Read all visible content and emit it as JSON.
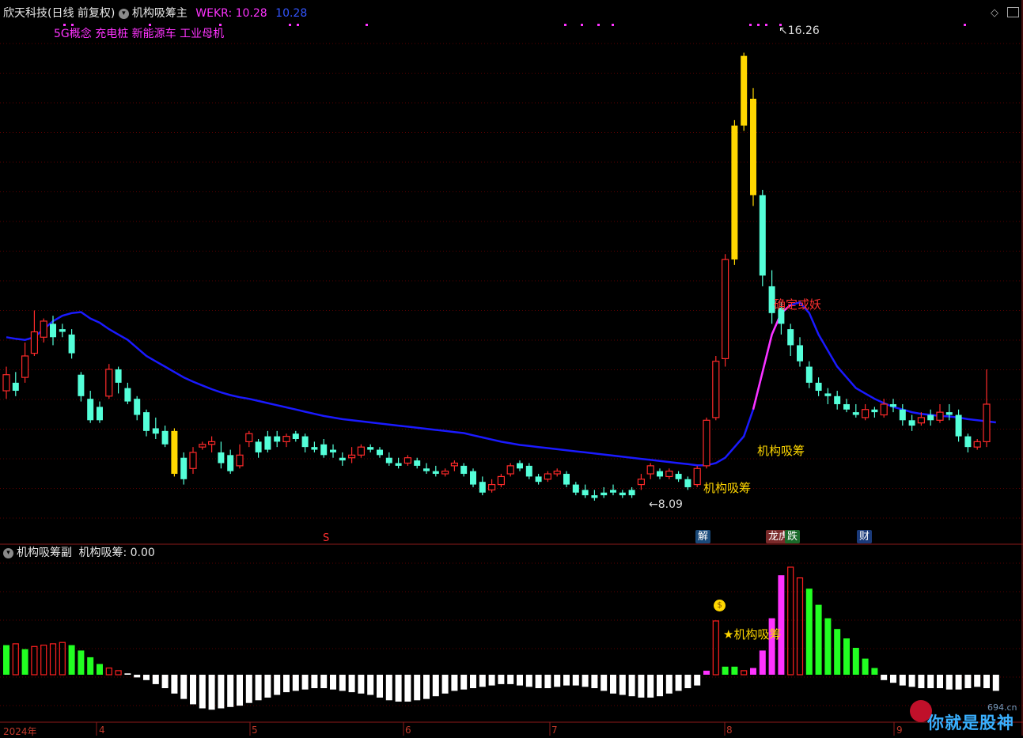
{
  "header": {
    "stock_name": "欣天科技",
    "period": "(日线 前复权)",
    "indicator": "机构吸筹主",
    "wekr_label": "WEKR:",
    "wekr_value1": "10.28",
    "wekr_value2": "10.28",
    "concepts": "5G概念 充电桩 新能源车 工业母机"
  },
  "markers": {
    "high": "16.26",
    "low": "8.09",
    "signal_main_1": "机构吸筹",
    "signal_main_2": "机构吸筹",
    "signal_sub": "★机构吸筹",
    "peak_text": "确定或妖",
    "event_s": "S",
    "event_jie": "解",
    "event_bang": "龙虎榜",
    "event_die": "跌",
    "event_cai": "财"
  },
  "sub": {
    "title": "机构吸筹副",
    "indicator": "机构吸筹:",
    "value": "0.00"
  },
  "xaxis": {
    "year": "2024年",
    "m4": "4",
    "m5": "5",
    "m6": "6",
    "m7": "7",
    "m8": "8",
    "m9": "9"
  },
  "watermark": {
    "text": "你就是股神",
    "site": "694.cn"
  },
  "colors": {
    "up": "#ff2a2a",
    "down": "#54ffd9",
    "ma": "#1a1aff",
    "accent_yellow": "#ffd700",
    "magenta": "#ff33ff",
    "bar_green": "#22ff22",
    "bar_white": "#ffffff"
  },
  "chart_data": {
    "type": "candlestick",
    "price_range": [
      7.5,
      16.8
    ],
    "candles": [
      [
        9.95,
        10.25,
        9.8,
        10.4
      ],
      [
        10.1,
        9.95,
        9.85,
        10.3
      ],
      [
        10.2,
        10.6,
        10.1,
        10.85
      ],
      [
        10.65,
        11.05,
        10.6,
        11.45
      ],
      [
        10.95,
        11.25,
        10.85,
        11.3
      ],
      [
        11.2,
        10.95,
        10.8,
        11.35
      ],
      [
        11.1,
        11.05,
        10.95,
        11.2
      ],
      [
        11.0,
        10.65,
        10.55,
        11.1
      ],
      [
        10.25,
        9.85,
        9.75,
        10.3
      ],
      [
        9.8,
        9.4,
        9.35,
        9.95
      ],
      [
        9.65,
        9.4,
        9.35,
        9.75
      ],
      [
        9.85,
        10.35,
        9.8,
        10.45
      ],
      [
        10.35,
        10.1,
        9.9,
        10.4
      ],
      [
        10.0,
        9.75,
        9.7,
        10.1
      ],
      [
        9.8,
        9.5,
        9.4,
        9.85
      ],
      [
        9.55,
        9.2,
        9.1,
        9.6
      ],
      [
        9.25,
        9.15,
        9.05,
        9.45
      ],
      [
        9.2,
        8.95,
        8.9,
        9.3
      ],
      [
        9.2,
        8.4,
        8.35,
        9.25
      ],
      [
        8.7,
        8.3,
        8.2,
        8.8
      ],
      [
        8.5,
        8.8,
        8.4,
        8.9
      ],
      [
        8.9,
        8.95,
        8.85,
        9.0
      ],
      [
        8.95,
        9.0,
        8.8,
        9.1
      ],
      [
        8.8,
        8.6,
        8.5,
        9.0
      ],
      [
        8.75,
        8.45,
        8.4,
        8.85
      ],
      [
        8.55,
        8.75,
        8.5,
        8.95
      ],
      [
        9.0,
        9.15,
        8.9,
        9.2
      ],
      [
        9.0,
        8.8,
        8.7,
        9.05
      ],
      [
        9.1,
        8.85,
        8.8,
        9.2
      ],
      [
        9.1,
        9.0,
        8.9,
        9.2
      ],
      [
        9.0,
        9.1,
        8.9,
        9.15
      ],
      [
        9.15,
        9.05,
        9.0,
        9.2
      ],
      [
        9.1,
        8.9,
        8.8,
        9.15
      ],
      [
        8.9,
        8.85,
        8.8,
        9.0
      ],
      [
        8.95,
        8.75,
        8.7,
        9.05
      ],
      [
        8.85,
        8.8,
        8.7,
        8.95
      ],
      [
        8.7,
        8.65,
        8.55,
        8.8
      ],
      [
        8.7,
        8.75,
        8.6,
        8.9
      ],
      [
        8.75,
        8.9,
        8.7,
        8.95
      ],
      [
        8.9,
        8.85,
        8.8,
        8.95
      ],
      [
        8.85,
        8.75,
        8.7,
        8.9
      ],
      [
        8.7,
        8.6,
        8.55,
        8.8
      ],
      [
        8.6,
        8.55,
        8.5,
        8.7
      ],
      [
        8.6,
        8.7,
        8.55,
        8.75
      ],
      [
        8.65,
        8.55,
        8.5,
        8.7
      ],
      [
        8.5,
        8.45,
        8.4,
        8.6
      ],
      [
        8.45,
        8.4,
        8.35,
        8.55
      ],
      [
        8.4,
        8.45,
        8.35,
        8.5
      ],
      [
        8.55,
        8.6,
        8.45,
        8.65
      ],
      [
        8.55,
        8.4,
        8.35,
        8.6
      ],
      [
        8.45,
        8.2,
        8.15,
        8.5
      ],
      [
        8.25,
        8.05,
        8.0,
        8.35
      ],
      [
        8.1,
        8.2,
        8.05,
        8.3
      ],
      [
        8.2,
        8.35,
        8.15,
        8.4
      ],
      [
        8.4,
        8.55,
        8.35,
        8.6
      ],
      [
        8.6,
        8.5,
        8.45,
        8.65
      ],
      [
        8.55,
        8.35,
        8.3,
        8.6
      ],
      [
        8.35,
        8.25,
        8.2,
        8.4
      ],
      [
        8.3,
        8.4,
        8.25,
        8.45
      ],
      [
        8.4,
        8.45,
        8.35,
        8.5
      ],
      [
        8.4,
        8.2,
        8.15,
        8.45
      ],
      [
        8.2,
        8.05,
        8.0,
        8.25
      ],
      [
        8.1,
        8.0,
        7.95,
        8.2
      ],
      [
        8.0,
        7.95,
        7.9,
        8.1
      ],
      [
        8.05,
        8.0,
        7.95,
        8.15
      ],
      [
        8.1,
        8.05,
        8.0,
        8.2
      ],
      [
        8.05,
        8.0,
        7.95,
        8.1
      ],
      [
        8.1,
        8.0,
        7.95,
        8.15
      ],
      [
        8.2,
        8.3,
        8.1,
        8.4
      ],
      [
        8.4,
        8.55,
        8.3,
        8.6
      ],
      [
        8.45,
        8.35,
        8.3,
        8.5
      ],
      [
        8.35,
        8.45,
        8.3,
        8.5
      ],
      [
        8.4,
        8.3,
        8.25,
        8.45
      ],
      [
        8.3,
        8.15,
        8.1,
        8.35
      ],
      [
        8.2,
        8.5,
        8.15,
        8.55
      ],
      [
        8.55,
        9.4,
        8.5,
        9.45
      ],
      [
        9.45,
        10.5,
        9.4,
        10.6
      ],
      [
        10.55,
        12.4,
        10.4,
        12.5
      ],
      [
        12.4,
        14.9,
        12.3,
        15.0
      ],
      [
        14.9,
        16.2,
        14.8,
        16.26
      ],
      [
        15.4,
        13.6,
        13.4,
        15.6
      ],
      [
        13.6,
        12.1,
        11.9,
        13.7
      ],
      [
        11.9,
        11.4,
        11.2,
        12.2
      ],
      [
        11.5,
        11.2,
        11.0,
        11.6
      ],
      [
        11.1,
        10.8,
        10.6,
        11.2
      ],
      [
        10.8,
        10.5,
        10.4,
        10.95
      ],
      [
        10.4,
        10.1,
        10.0,
        10.5
      ],
      [
        10.1,
        9.95,
        9.85,
        10.2
      ],
      [
        9.9,
        9.85,
        9.7,
        10.0
      ],
      [
        9.85,
        9.7,
        9.6,
        9.95
      ],
      [
        9.7,
        9.6,
        9.55,
        9.8
      ],
      [
        9.55,
        9.5,
        9.45,
        9.7
      ],
      [
        9.45,
        9.6,
        9.4,
        9.7
      ],
      [
        9.6,
        9.55,
        9.45,
        9.65
      ],
      [
        9.5,
        9.7,
        9.45,
        9.8
      ],
      [
        9.7,
        9.65,
        9.55,
        9.8
      ],
      [
        9.6,
        9.4,
        9.3,
        9.7
      ],
      [
        9.4,
        9.3,
        9.2,
        9.5
      ],
      [
        9.35,
        9.45,
        9.3,
        9.55
      ],
      [
        9.5,
        9.4,
        9.3,
        9.6
      ],
      [
        9.4,
        9.55,
        9.35,
        9.7
      ],
      [
        9.55,
        9.5,
        9.4,
        9.7
      ],
      [
        9.5,
        9.1,
        9.0,
        9.6
      ],
      [
        9.1,
        8.9,
        8.8,
        9.15
      ],
      [
        8.9,
        9.0,
        8.85,
        9.05
      ],
      [
        9.0,
        9.7,
        8.9,
        10.35
      ]
    ],
    "ma_values": [
      10.95,
      10.92,
      10.9,
      10.95,
      11.1,
      11.25,
      11.35,
      11.4,
      11.42,
      11.3,
      11.22,
      11.1,
      11.0,
      10.9,
      10.75,
      10.6,
      10.5,
      10.4,
      10.3,
      10.2,
      10.12,
      10.05,
      9.98,
      9.92,
      9.87,
      9.83,
      9.8,
      9.76,
      9.72,
      9.68,
      9.64,
      9.6,
      9.56,
      9.52,
      9.48,
      9.45,
      9.42,
      9.4,
      9.38,
      9.36,
      9.34,
      9.32,
      9.3,
      9.28,
      9.26,
      9.24,
      9.22,
      9.2,
      9.18,
      9.16,
      9.12,
      9.08,
      9.04,
      9.0,
      8.97,
      8.94,
      8.92,
      8.9,
      8.88,
      8.86,
      8.84,
      8.82,
      8.8,
      8.78,
      8.76,
      8.74,
      8.72,
      8.7,
      8.68,
      8.66,
      8.64,
      8.62,
      8.6,
      8.58,
      8.56,
      8.56,
      8.6,
      8.7,
      8.9,
      9.1,
      9.6,
      10.3,
      11.0,
      11.4,
      11.55,
      11.6,
      11.4,
      11.0,
      10.7,
      10.4,
      10.2,
      10.0,
      9.9,
      9.8,
      9.72,
      9.65,
      9.6,
      9.55,
      9.52,
      9.5,
      9.48,
      9.47,
      9.45,
      9.42,
      9.4,
      9.38,
      9.36
    ],
    "sub_values": [
      2.2,
      2.3,
      1.9,
      2.1,
      2.2,
      2.3,
      2.4,
      2.2,
      1.8,
      1.3,
      0.8,
      0.5,
      0.3,
      0.1,
      -0.2,
      -0.4,
      -0.7,
      -1.0,
      -1.4,
      -1.8,
      -2.2,
      -2.5,
      -2.6,
      -2.5,
      -2.4,
      -2.3,
      -2.1,
      -1.9,
      -1.7,
      -1.5,
      -1.3,
      -1.2,
      -1.1,
      -1.0,
      -1.0,
      -1.1,
      -1.2,
      -1.3,
      -1.4,
      -1.5,
      -1.7,
      -1.9,
      -2.0,
      -2.0,
      -1.9,
      -1.8,
      -1.6,
      -1.4,
      -1.2,
      -1.1,
      -1.0,
      -0.9,
      -0.8,
      -0.7,
      -0.7,
      -0.8,
      -0.9,
      -1.0,
      -1.0,
      -0.9,
      -0.8,
      -0.8,
      -0.9,
      -1.0,
      -1.2,
      -1.4,
      -1.5,
      -1.6,
      -1.7,
      -1.7,
      -1.6,
      -1.4,
      -1.2,
      -1.0,
      -0.8,
      0.3,
      4.0,
      0.6,
      0.6,
      0.3,
      0.5,
      1.8,
      4.2,
      7.4,
      8.0,
      7.2,
      6.4,
      5.2,
      4.2,
      3.4,
      2.7,
      2.0,
      1.2,
      0.5,
      -0.4,
      -0.6,
      -0.8,
      -0.9,
      -1.0,
      -1.0,
      -1.0,
      -1.1,
      -1.1,
      -1.0,
      -0.9,
      -1.0,
      -1.2
    ],
    "sub_colors": [
      "g",
      "r",
      "g",
      "r",
      "r",
      "r",
      "r",
      "g",
      "g",
      "g",
      "g",
      "r",
      "r",
      "w",
      "w",
      "w",
      "w",
      "w",
      "w",
      "w",
      "w",
      "w",
      "w",
      "w",
      "w",
      "w",
      "w",
      "w",
      "w",
      "w",
      "w",
      "w",
      "w",
      "w",
      "w",
      "w",
      "w",
      "w",
      "w",
      "w",
      "w",
      "w",
      "w",
      "w",
      "w",
      "w",
      "w",
      "w",
      "w",
      "w",
      "w",
      "w",
      "w",
      "w",
      "w",
      "w",
      "w",
      "w",
      "w",
      "w",
      "w",
      "w",
      "w",
      "w",
      "w",
      "w",
      "w",
      "w",
      "w",
      "w",
      "w",
      "w",
      "w",
      "w",
      "w",
      "m",
      "r",
      "g",
      "g",
      "r",
      "m",
      "m",
      "m",
      "m",
      "r",
      "r",
      "g",
      "g",
      "g",
      "g",
      "g",
      "g",
      "g",
      "g",
      "w",
      "w",
      "w",
      "w",
      "w",
      "w",
      "w",
      "w",
      "w",
      "w",
      "w",
      "w",
      "w"
    ]
  }
}
